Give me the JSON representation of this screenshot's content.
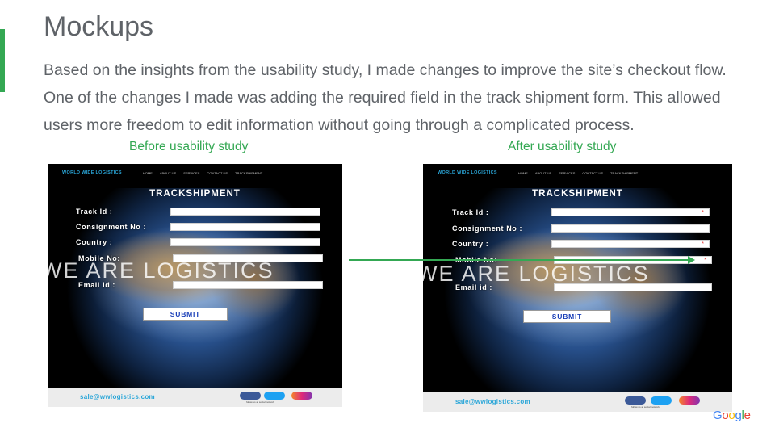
{
  "slide": {
    "title": "Mockups",
    "body_lines": [
      "Based on the insights from the usability study, I made changes to improve the site’s checkout flow.",
      "One of the changes I made was adding the required field in the track shipment form. This allowed",
      "users more freedom to edit information  without going through a complicated process."
    ],
    "caption_before": "Before usability study",
    "caption_after": "After usability study",
    "logo": "Google"
  },
  "mockup": {
    "logo": "WORLD WIDE LOGISTICS",
    "nav": [
      "HOME",
      "ABOUT US",
      "SERVICES",
      "CONTACT US",
      "TRACKSHIPMENT"
    ],
    "heading": "TRACKSHIPMENT",
    "watermark": "WE ARE LOGISTICS",
    "labels_before": {
      "track_id": "Track Id :",
      "consignment": "Consignment No :",
      "country": "Country :",
      "mobile": "Mobile No:",
      "email": "Email id :"
    },
    "labels_after": {
      "track_id": "Track Id :",
      "consignment": "Consignment No :",
      "country": "Country :",
      "mobile": "Mobile No:",
      "email": "Email id :"
    },
    "required_marker": "*",
    "submit": "SUBMIT",
    "footer_email": "sale@wwlogistics.com",
    "footer_social_text": "follow us at social network"
  },
  "colors": {
    "accent_green": "#34a853",
    "text_gray": "#5f6368",
    "logistics_blue": "#2aa6d8",
    "submit_blue": "#1a3fb8",
    "required_red": "#e53935"
  }
}
